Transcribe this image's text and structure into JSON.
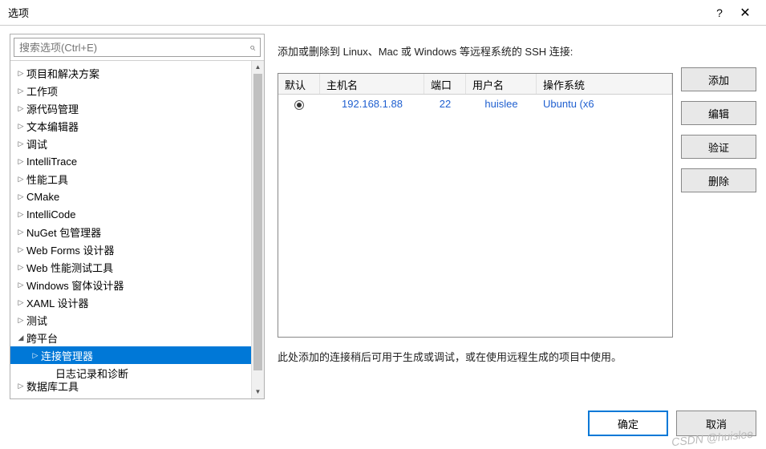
{
  "window": {
    "title": "选项",
    "help": "?",
    "close": "✕"
  },
  "search": {
    "placeholder": "搜索选项(Ctrl+E)"
  },
  "tree": {
    "items": [
      {
        "label": "项目和解决方案",
        "level": 0,
        "expanded": false
      },
      {
        "label": "工作项",
        "level": 0,
        "expanded": false
      },
      {
        "label": "源代码管理",
        "level": 0,
        "expanded": false
      },
      {
        "label": "文本编辑器",
        "level": 0,
        "expanded": false
      },
      {
        "label": "调试",
        "level": 0,
        "expanded": false
      },
      {
        "label": "IntelliTrace",
        "level": 0,
        "expanded": false
      },
      {
        "label": "性能工具",
        "level": 0,
        "expanded": false
      },
      {
        "label": "CMake",
        "level": 0,
        "expanded": false
      },
      {
        "label": "IntelliCode",
        "level": 0,
        "expanded": false
      },
      {
        "label": "NuGet 包管理器",
        "level": 0,
        "expanded": false
      },
      {
        "label": "Web Forms 设计器",
        "level": 0,
        "expanded": false
      },
      {
        "label": "Web 性能测试工具",
        "level": 0,
        "expanded": false
      },
      {
        "label": "Windows 窗体设计器",
        "level": 0,
        "expanded": false
      },
      {
        "label": "XAML 设计器",
        "level": 0,
        "expanded": false
      },
      {
        "label": "测试",
        "level": 0,
        "expanded": false
      },
      {
        "label": "跨平台",
        "level": 0,
        "expanded": true
      },
      {
        "label": "连接管理器",
        "level": 1,
        "expanded": false,
        "selected": true
      },
      {
        "label": "日志记录和诊断",
        "level": 2,
        "expanded": false,
        "noarrow": true
      },
      {
        "label": "数据库工具",
        "level": 0,
        "expanded": false,
        "cut": true
      }
    ]
  },
  "main": {
    "desc1": "添加或删除到 Linux、Mac 或 Windows 等远程系统的 SSH 连接:",
    "headers": {
      "default": "默认",
      "host": "主机名",
      "port": "端口",
      "user": "用户名",
      "os": "操作系统"
    },
    "row": {
      "host": "192.168.1.88",
      "port": "22",
      "user": "huislee",
      "os": "Ubuntu (x6"
    },
    "desc2": "此处添加的连接稍后可用于生成或调试，或在使用远程生成的项目中使用。"
  },
  "buttons": {
    "add": "添加",
    "edit": "编辑",
    "verify": "验证",
    "delete": "删除"
  },
  "footer": {
    "ok": "确定",
    "cancel": "取消"
  },
  "watermark": "CSDN @huislee"
}
